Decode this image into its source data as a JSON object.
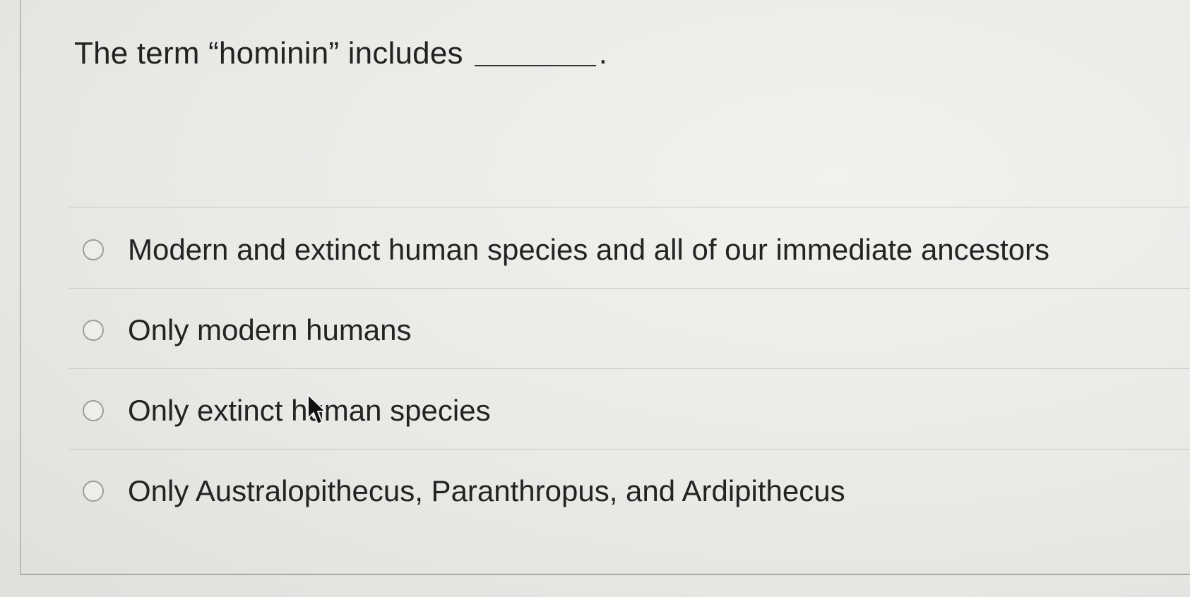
{
  "question": {
    "text": "The term “hominin” includes",
    "blank_end": "."
  },
  "options": [
    {
      "label": "Modern and extinct human species and all of our immediate ancestors",
      "selected": false
    },
    {
      "label": "Only modern humans",
      "selected": false
    },
    {
      "label": "Only extinct human species",
      "selected": false
    },
    {
      "label": "Only Australopithecus, Paranthropus, and Ardipithecus",
      "selected": false
    }
  ],
  "icons": {
    "radio": "radio-button-unchecked-icon",
    "cursor": "mouse-pointer-icon"
  }
}
